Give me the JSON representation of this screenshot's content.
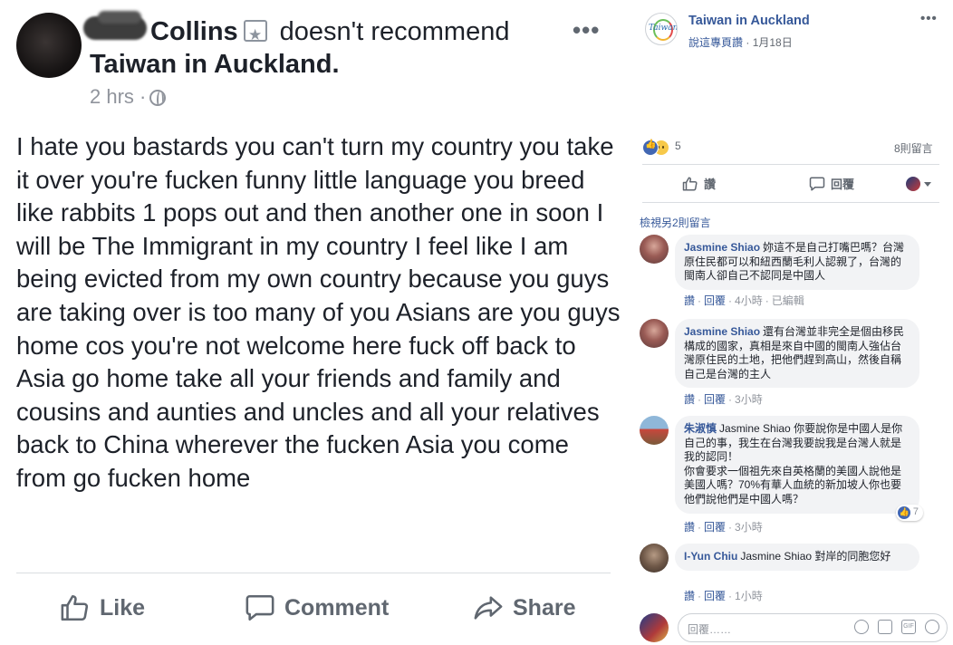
{
  "left_post": {
    "author_name": "Collins",
    "verb": "doesn't recommend",
    "target_page": "Taiwan in Auckland.",
    "time": "2 hrs",
    "separator": "·",
    "body": "I hate you bastards you can't turn my country you take it over you're fucken funny little language you breed like rabbits 1 pops out and then another one in soon I will be The Immigrant in my country I feel like I am being evicted from my own country because you guys are taking over is too many of you Asians are you guys home cos you're not welcome here fuck off back to Asia go home take all your friends and family and cousins and aunties and uncles and all your relatives back to China wherever the fucken Asia you come from go fucken home",
    "actions": {
      "like": "Like",
      "comment": "Comment",
      "share": "Share"
    }
  },
  "right_post": {
    "page_name": "Taiwan in Auckland",
    "page_logo_text": "Taiwan",
    "meta_link": "說這專頁讚",
    "meta_sep": "·",
    "date": "1月18日",
    "reaction_count": "5",
    "comment_count": "8則留言",
    "like_button": "讚",
    "comment_button": "回覆",
    "view_more": "檢視另2則留言",
    "comments": [
      {
        "name": "Jasmine Shiao",
        "text": "妳這不是自己打嘴巴嗎？台灣原住民都可以和紐西蘭毛利人認親了，台灣的閩南人卻自己不認同是中國人",
        "like": "讚",
        "reply": "回覆",
        "time": "4小時",
        "edited": "已編輯"
      },
      {
        "name": "Jasmine Shiao",
        "text": "還有台灣並非完全是個由移民構成的國家，真相是來自中國的閩南人強佔台灣原住民的土地，把他們趕到高山，然後自稱自己是台灣的主人",
        "like": "讚",
        "reply": "回覆",
        "time": "3小時"
      },
      {
        "name": "朱淑慎",
        "mention": "Jasmine Shiao",
        "text_line1": "你要說你是中國人是你自己的事，我生在台灣我要說我是台灣人就是我的認同！",
        "text_line2": "你會要求一個祖先來自英格蘭的美國人說他是美國人嗎？70%有華人血統的新加坡人你也要他們說他們是中國人嗎？",
        "reactions": "7",
        "like": "讚",
        "reply": "回覆",
        "time": "3小時"
      },
      {
        "name": "I-Yun Chiu",
        "mention": "Jasmine Shiao",
        "text": "對岸的同胞您好",
        "like": "讚",
        "reply": "回覆",
        "time": "1小時"
      }
    ],
    "reply_placeholder": "回覆……"
  },
  "colors": {
    "link_blue": "#365899",
    "facebook_blue": "#4267b2",
    "bubble_grey": "#f2f3f5",
    "meta_grey": "#90949c"
  }
}
